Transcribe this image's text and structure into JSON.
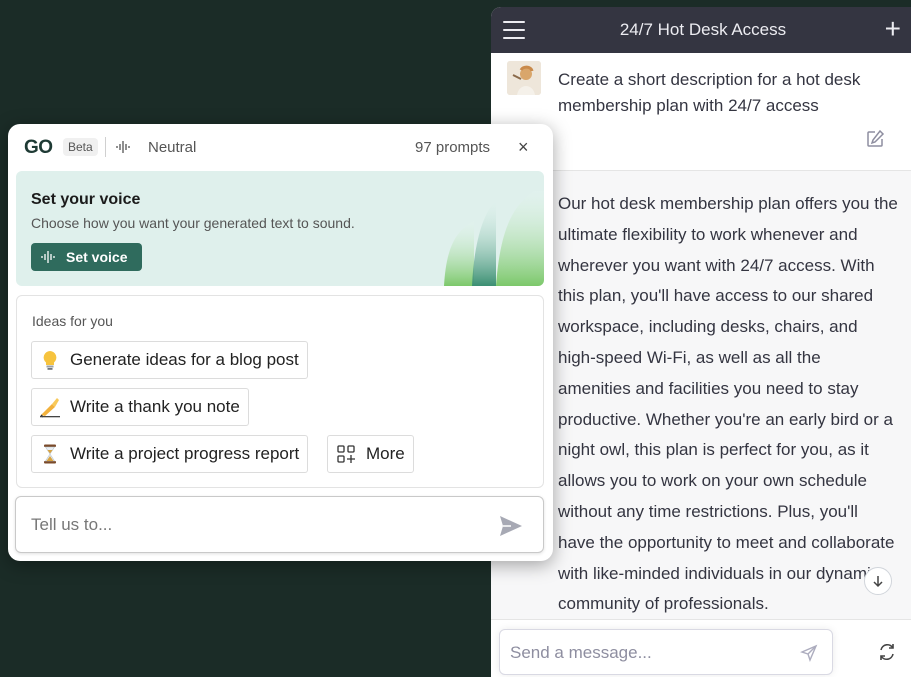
{
  "chat": {
    "title": "24/7 Hot Desk Access",
    "user_message": "Create a short description for a hot desk membership plan with 24/7 access",
    "assistant_message": "Our hot desk membership plan offers you the ultimate flexibility to work whenever and wherever you want with 24/7 access. With this plan, you'll have access to our shared workspace, including desks, chairs, and high-speed Wi-Fi, as well as all the amenities and facilities you need to stay productive. Whether you're an early bird or a night owl, this plan is perfect for you, as it allows you to work on your own schedule without any time restrictions. Plus, you'll have the opportunity to meet and collaborate with like-minded individuals in our dynamic community of professionals.",
    "input_placeholder": "Send a message...",
    "colors": {
      "header_bg": "#343541",
      "assistant_bg": "#f7f7f8"
    }
  },
  "go": {
    "logo": "GO",
    "beta": "Beta",
    "voice": "Neutral",
    "prompts": "97 prompts",
    "close": "×",
    "voice_card": {
      "title": "Set your voice",
      "subtitle": "Choose how you want your generated text to sound.",
      "button": "Set voice"
    },
    "ideas_label": "Ideas for you",
    "ideas": [
      {
        "icon": "lightbulb-icon",
        "label": "Generate ideas for a blog post"
      },
      {
        "icon": "writing-hand-icon",
        "label": "Write a thank you note"
      },
      {
        "icon": "hourglass-icon",
        "label": "Write a project progress report"
      },
      {
        "icon": "apps-plus-icon",
        "label": "More"
      }
    ],
    "input_placeholder": "Tell us to...",
    "colors": {
      "accent": "#2f6b5d",
      "card_bg": "#dff0ec"
    }
  },
  "background_color": "#1b2c27"
}
